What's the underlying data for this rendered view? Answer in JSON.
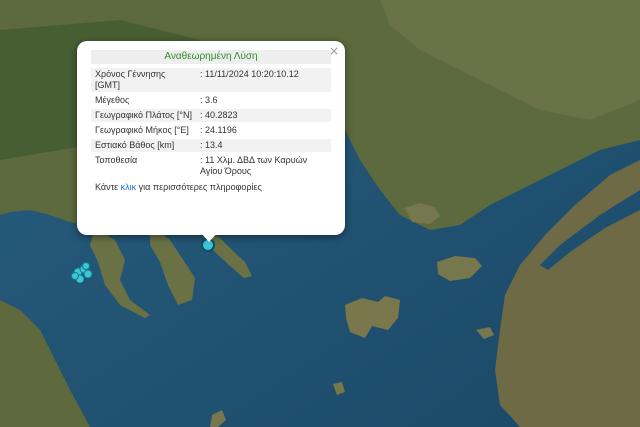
{
  "popup": {
    "title": "Αναθεωρημένη Λύση",
    "close_label": "×",
    "rows": [
      {
        "label": "Χρόνος Γέννησης [GMT]",
        "value": ": 11/11/2024 10:20:10.12"
      },
      {
        "label": "Μέγεθος",
        "value": ": 3.6"
      },
      {
        "label": "Γεωγραφικό Πλάτος [°N]",
        "value": ": 40.2823"
      },
      {
        "label": "Γεωγραφικό Μήκος [°E]",
        "value": ": 24.1196"
      },
      {
        "label": "Εστιακό Βάθος [km]",
        "value": ": 13.4"
      },
      {
        "label": "Τοποθεσία",
        "value": ": 11 Χλμ. ΔΒΔ των Καρυών Αγίου Όρους"
      }
    ],
    "footer_pre": "Κάντε ",
    "footer_link": "κλικ",
    "footer_post": " για περισσότερες πληροφορίες"
  },
  "colors": {
    "sea": "#1f4f6e",
    "land": "#5f6b3f",
    "marker": "#3fc6d6",
    "title_text": "#2e8b2e",
    "link": "#1a6fd1"
  },
  "markers": {
    "selected_icon": "selected-earthquake-marker",
    "cluster_icon": "earthquake-marker"
  }
}
